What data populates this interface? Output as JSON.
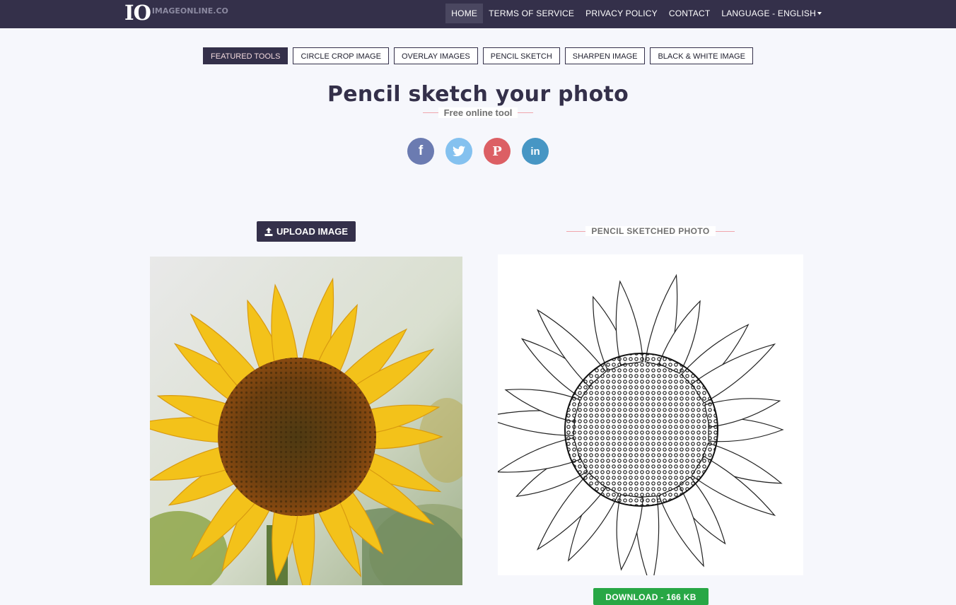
{
  "brand": {
    "mark": "IO",
    "name": "IMAGEONLINE.CO"
  },
  "nav": {
    "home": "HOME",
    "terms": "TERMS OF SERVICE",
    "privacy": "PRIVACY POLICY",
    "contact": "CONTACT",
    "language": "LANGUAGE - ENGLISH"
  },
  "tools": [
    "FEATURED TOOLS",
    "CIRCLE CROP IMAGE",
    "OVERLAY IMAGES",
    "PENCIL SKETCH",
    "SHARPEN IMAGE",
    "BLACK & WHITE IMAGE"
  ],
  "header": {
    "title": "Pencil sketch your photo",
    "subtitle": "Free online tool"
  },
  "social": [
    {
      "icon": "facebook-icon",
      "glyph": "f",
      "color": "#6b7bb1"
    },
    {
      "icon": "twitter-icon",
      "glyph": "",
      "color": "#84c1ef"
    },
    {
      "icon": "pinterest-icon",
      "glyph": "P",
      "color": "#dc5f64"
    },
    {
      "icon": "linkedin-icon",
      "glyph": "in",
      "color": "#4796c4"
    }
  ],
  "upload": {
    "icon": "upload-icon",
    "label": "UPLOAD IMAGE"
  },
  "result": {
    "label": "PENCIL SKETCHED PHOTO"
  },
  "download": {
    "label": "DOWNLOAD - 166 KB"
  },
  "colors": {
    "nav": "#34304a",
    "accent_rule": "#f0a6ad",
    "download": "#28a745",
    "petal": "#f3c21a",
    "center": "#6b3d12"
  }
}
